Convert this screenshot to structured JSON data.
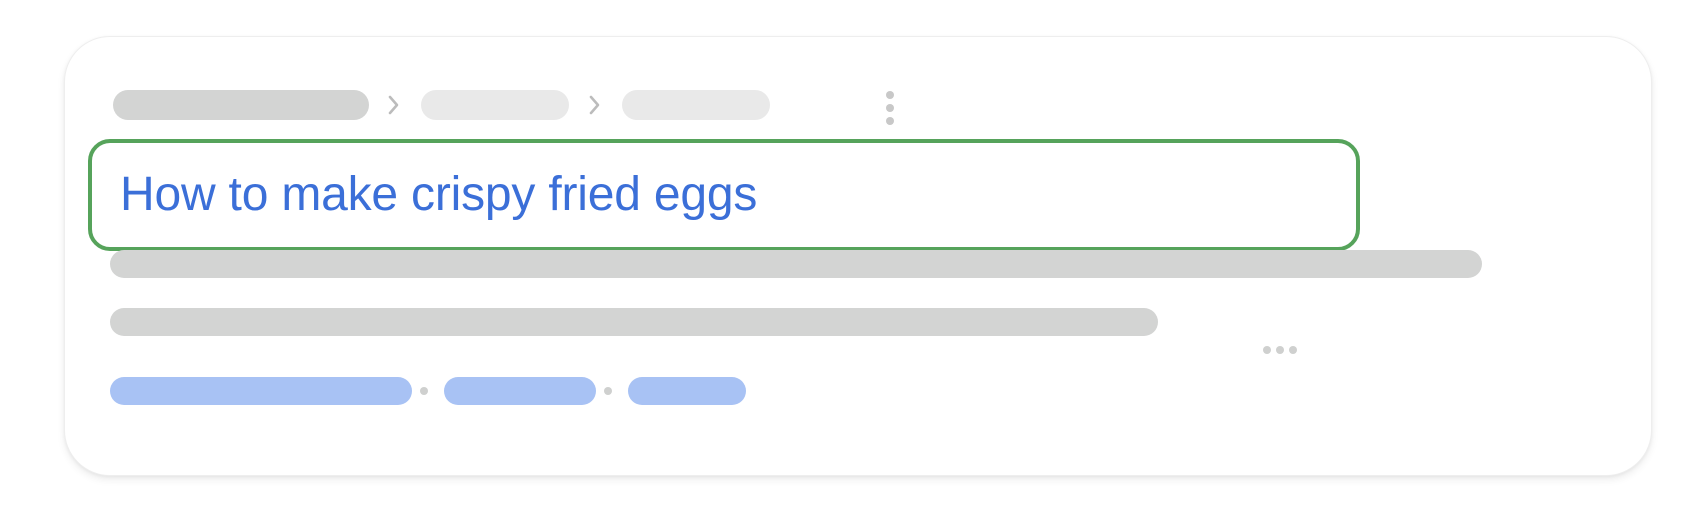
{
  "result": {
    "title": "How to make crispy fried eggs"
  },
  "colors": {
    "title_text": "#3b6fd8",
    "highlight_border": "#56a35b",
    "placeholder_gray": "#d3d4d3",
    "placeholder_light": "#e9e9e9",
    "placeholder_blue": "#a8c2f4"
  },
  "icons": {
    "breadcrumb_separator": "chevron-right-icon",
    "more_options": "more-vertical-icon",
    "truncation": "ellipsis-icon"
  }
}
